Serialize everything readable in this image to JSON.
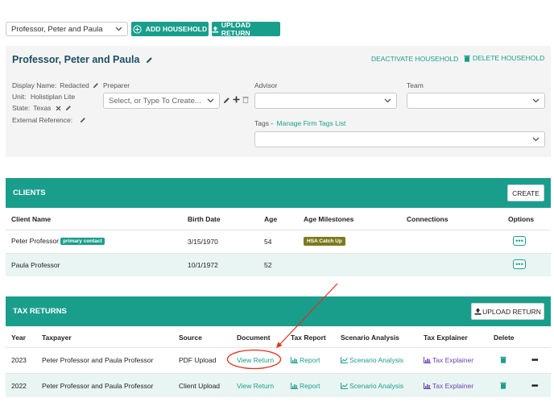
{
  "top": {
    "household_select": "Professor, Peter and Paula",
    "add_household": "ADD HOUSEHOLD",
    "upload_return": "UPLOAD RETURN"
  },
  "household": {
    "title": "Professor, Peter and Paula",
    "deactivate": "DEACTIVATE HOUSEHOLD",
    "delete": "DELETE HOUSEHOLD",
    "display_name_label": "Display Name:",
    "display_name_value": "Redacted",
    "unit_label": "Unit:",
    "unit_value": "Holistiplan Lite",
    "state_label": "State:",
    "state_value": "Texas",
    "external_ref_label": "External Reference:",
    "preparer_label": "Preparer",
    "preparer_placeholder": "Select, or Type To Create...",
    "advisor_label": "Advisor",
    "team_label": "Team",
    "tags_label": "Tags -",
    "tags_link": "Manage Firm Tags List"
  },
  "clients": {
    "title": "CLIENTS",
    "create": "CREATE",
    "headers": [
      "Client Name",
      "Birth Date",
      "Age",
      "Age Milestones",
      "Connections",
      "Options"
    ],
    "rows": [
      {
        "name": "Peter Professor",
        "badge": "primary contact",
        "birth": "3/15/1970",
        "age": "54",
        "milestone": "HSA Catch Up"
      },
      {
        "name": "Paula Professor",
        "badge": "",
        "birth": "10/1/1972",
        "age": "52",
        "milestone": ""
      }
    ]
  },
  "tax_returns": {
    "title": "TAX RETURNS",
    "upload": "UPLOAD RETURN",
    "headers": [
      "Year",
      "Taxpayer",
      "Source",
      "Document",
      "Tax Report",
      "Scenario Analysis",
      "Tax Explainer",
      "Delete"
    ],
    "rows": [
      {
        "year": "2023",
        "taxpayer": "Peter Professor and Paula Professor",
        "source": "PDF Upload",
        "document": "View Return",
        "report": "Report",
        "scenario": "Scenario Analysis",
        "explainer": "Tax Explainer"
      },
      {
        "year": "2022",
        "taxpayer": "Peter Professor and Paula Professor",
        "source": "Client Upload",
        "document": "View Return",
        "report": "Report",
        "scenario": "Scenario Analysis",
        "explainer": "Tax Explainer"
      }
    ]
  },
  "colors": {
    "teal": "#1a9e8c",
    "annotation_red": "#e0301e",
    "purple": "#6a3fb5"
  }
}
